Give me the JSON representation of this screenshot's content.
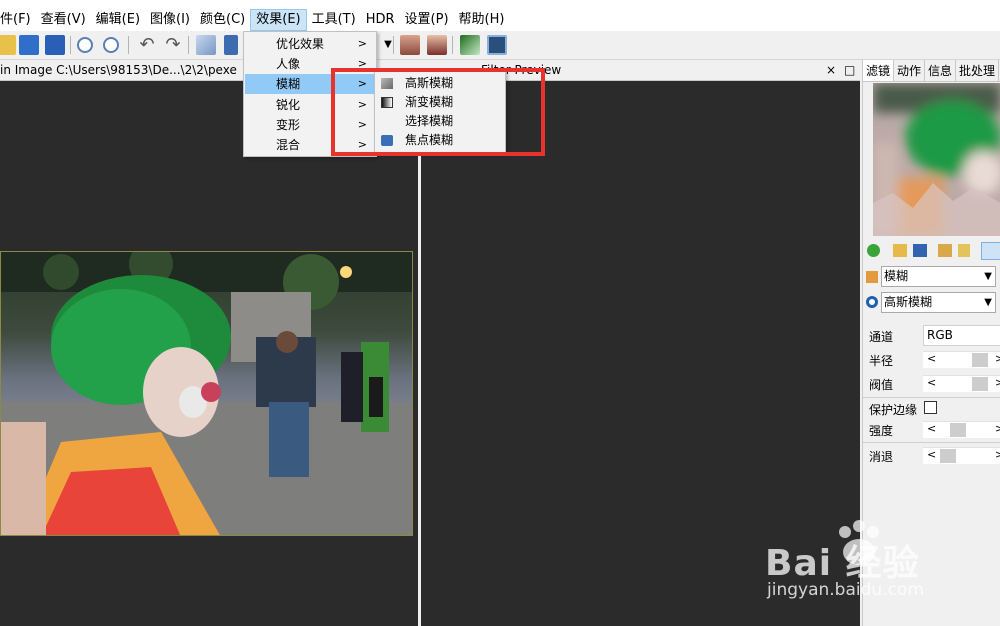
{
  "menubar": {
    "items": [
      {
        "label": "件(F)"
      },
      {
        "label": "查看(V)"
      },
      {
        "label": "编辑(E)"
      },
      {
        "label": "图像(I)"
      },
      {
        "label": "颜色(C)"
      },
      {
        "label": "效果(E)"
      },
      {
        "label": "工具(T)"
      },
      {
        "label": "HDR"
      },
      {
        "label": "设置(P)"
      },
      {
        "label": "帮助(H)"
      }
    ]
  },
  "document": {
    "left_title": "in Image C:\\Users\\98153\\De...\\2\\2\\pexe",
    "right_title": "Filter Preview",
    "close_glyph": "×",
    "max_glyph": "□"
  },
  "effects_menu": {
    "items": [
      {
        "label": "优化效果",
        "submenu": ">"
      },
      {
        "label": "人像",
        "submenu": ">"
      },
      {
        "label": "模糊",
        "submenu": ">"
      },
      {
        "label": "锐化",
        "submenu": ">"
      },
      {
        "label": "变形",
        "submenu": ">"
      },
      {
        "label": "混合",
        "submenu": ">"
      }
    ]
  },
  "blur_submenu": {
    "items": [
      {
        "label": "高斯模糊",
        "icon": "gaussian-blur-icon"
      },
      {
        "label": "渐变模糊",
        "icon": "gradient-blur-icon"
      },
      {
        "label": "选择模糊",
        "icon": ""
      },
      {
        "label": "焦点模糊",
        "icon": "focus-blur-icon"
      }
    ]
  },
  "right_panel": {
    "tabs": [
      {
        "label": "滤镜"
      },
      {
        "label": "动作"
      },
      {
        "label": "信息"
      },
      {
        "label": "批处理"
      }
    ],
    "category_select": "模糊",
    "filter_select": "高斯模糊",
    "params": {
      "channel_label": "通道",
      "channel_value": "RGB",
      "radius_label": "半径",
      "threshold_label": "阀值",
      "preserve_edges_label": "保护边缘",
      "strength_label": "强度",
      "fade_label": "消退",
      "left_arrow": "<",
      "right_arrow": ">"
    }
  },
  "watermark": {
    "big": "Bai 经验",
    "small": "jingyan.baidu.com"
  },
  "colors": {
    "highlight": "#91c9f7",
    "annotation_red": "#e8332c",
    "canvas_bg": "#2b2b2b"
  }
}
